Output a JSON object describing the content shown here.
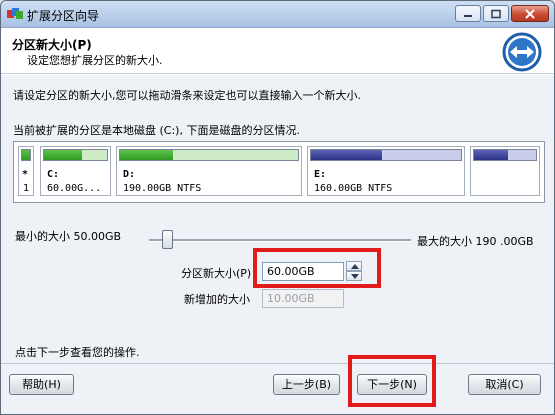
{
  "window": {
    "title": "扩展分区向导",
    "controls": {
      "minimize": "minimize-icon",
      "maximize": "maximize-icon",
      "close": "close-icon"
    }
  },
  "header": {
    "title": "分区新大小(P)",
    "subtitle": "设定您想扩展分区的新大小."
  },
  "instruction": "请设定分区的新大小,您可以拖动滑条来设定也可以直接输入一个新大小.",
  "disk_caption": "当前被扩展的分区是本地磁盘 (C:), 下面是磁盘的分区情况.",
  "disk": {
    "marker": {
      "star": "*",
      "number": "1"
    },
    "partitions": [
      {
        "name": "C:",
        "info": "60.00G...",
        "color": "green",
        "used_fraction": 0.6
      },
      {
        "name": "D:",
        "info": "190.00GB NTFS",
        "color": "green",
        "used_fraction": 0.3
      },
      {
        "name": "E:",
        "info": "160.00GB NTFS",
        "color": "blue",
        "used_fraction": 0.47
      },
      {
        "name": "",
        "info": "",
        "color": "blue",
        "used_fraction": 0.55
      }
    ]
  },
  "slider": {
    "min_label": "最小的大小 50.00GB",
    "max_label": "最大的大小 190 .00GB",
    "position_fraction": 0.08
  },
  "new_size": {
    "label": "分区新大小(P)",
    "value": "60.00GB"
  },
  "added_size": {
    "label": "新增加的大小",
    "value": "10.00GB"
  },
  "footer_hint": "点击下一步查看您的操作.",
  "buttons": {
    "help": "帮助(H)",
    "back": "上一步(B)",
    "next": "下一步(N)",
    "cancel": "取消(C)"
  },
  "colors": {
    "green": "#3faa2e",
    "blue": "#3a41a0",
    "highlight": "#e11b1b"
  }
}
